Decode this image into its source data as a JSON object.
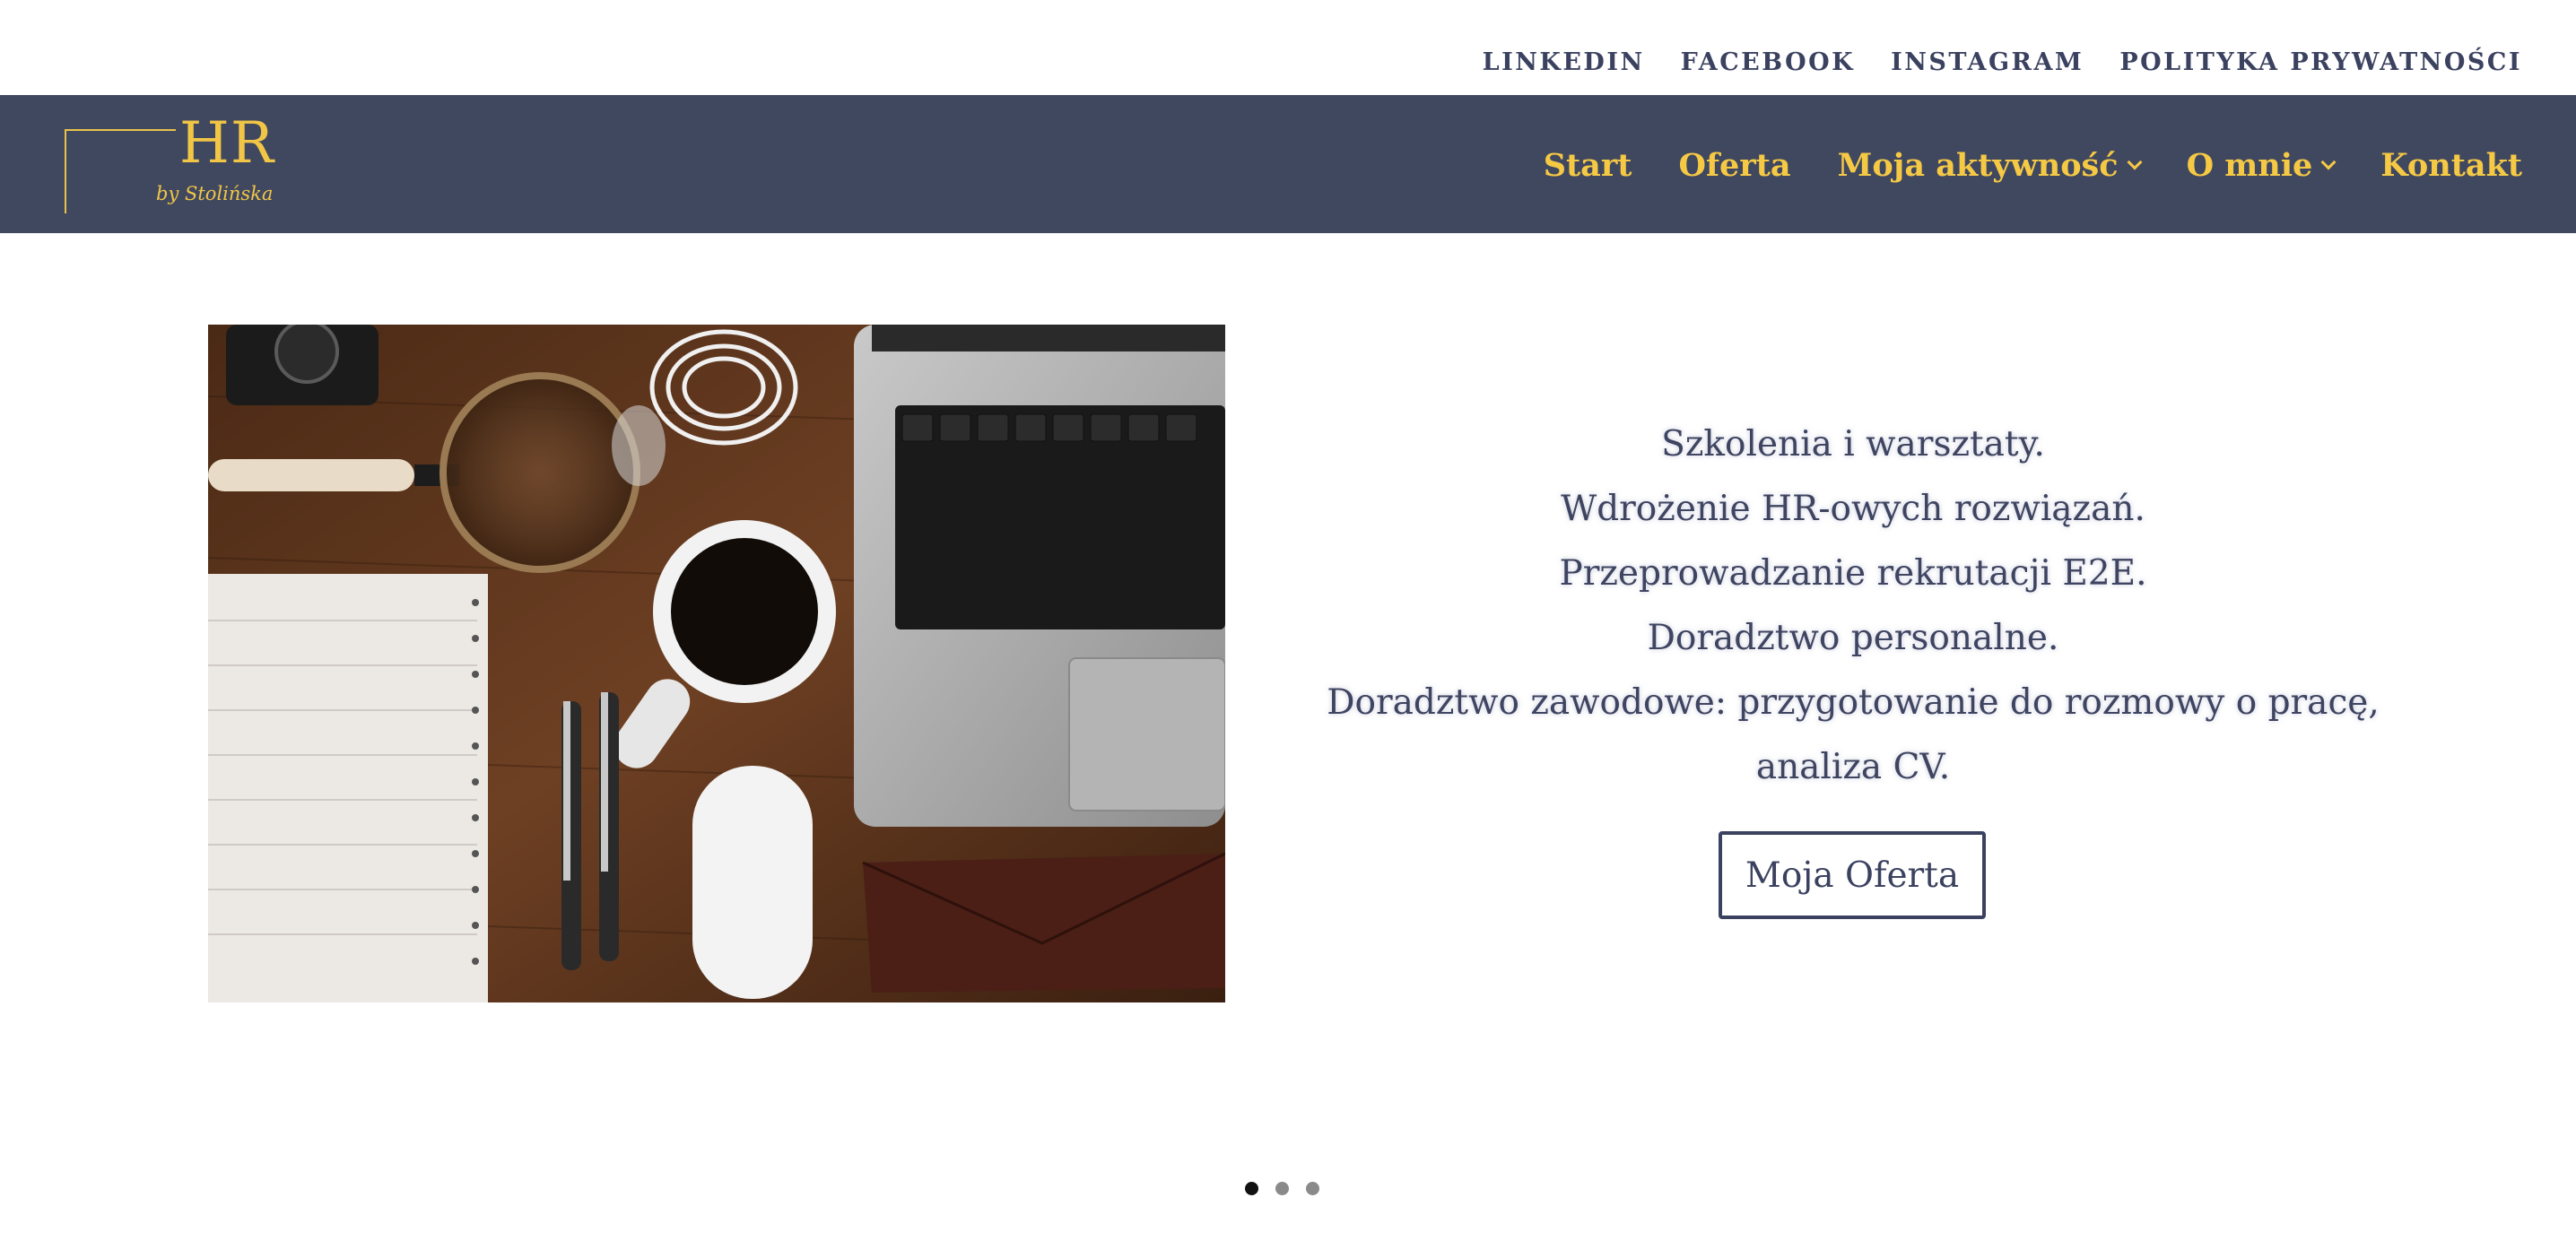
{
  "top_links": [
    "LINKEDIN",
    "FACEBOOK",
    "INSTAGRAM",
    "POLITYKA PRYWATNOŚCI"
  ],
  "logo": {
    "main": "HR",
    "sub": "by  Stolińska"
  },
  "nav": [
    {
      "label": "Start",
      "has_dropdown": false
    },
    {
      "label": "Oferta",
      "has_dropdown": false
    },
    {
      "label": "Moja aktywność",
      "has_dropdown": true
    },
    {
      "label": "O mnie",
      "has_dropdown": true
    },
    {
      "label": "Kontakt",
      "has_dropdown": false
    }
  ],
  "hero": {
    "lines": [
      "Szkolenia i warsztaty.",
      "Wdrożenie HR-owych rozwiązań.",
      "Przeprowadzanie rekrutacji E2E.",
      "Doradztwo personalne.",
      "Doradztwo zawodowe: przygotowanie do rozmowy o pracę,",
      "analiza CV."
    ],
    "cta_label": "Moja Oferta"
  },
  "slider": {
    "count": 3,
    "active_index": 0
  },
  "colors": {
    "navy": "#40485f",
    "gold": "#f6c945",
    "text": "#3f4461"
  }
}
